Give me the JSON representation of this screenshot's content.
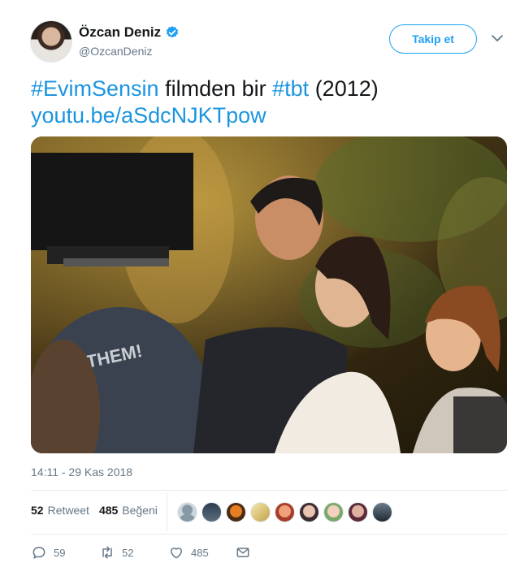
{
  "header": {
    "display_name": "Özcan Deniz",
    "handle": "@OzcanDeniz",
    "follow_label": "Takip et",
    "verified_icon": "verified-badge-icon",
    "menu_icon": "chevron-down-icon"
  },
  "tweet": {
    "hashtag1": "#EvimSensin",
    "text1": " filmden bir ",
    "hashtag2": "#tbt",
    "text2": " (2012)",
    "link": "youtu.be/aSdcNJKTpow"
  },
  "timestamp": "14:11 - 29 Kas 2018",
  "stats": {
    "retweets_count": "52",
    "retweets_label": "Retweet",
    "likes_count": "485",
    "likes_label": "Beğeni"
  },
  "actions": {
    "reply_count": "59",
    "retweet_count": "52",
    "like_count": "485"
  },
  "colors": {
    "accent": "#1da1f2",
    "link": "#1b95e0",
    "muted": "#657786"
  }
}
